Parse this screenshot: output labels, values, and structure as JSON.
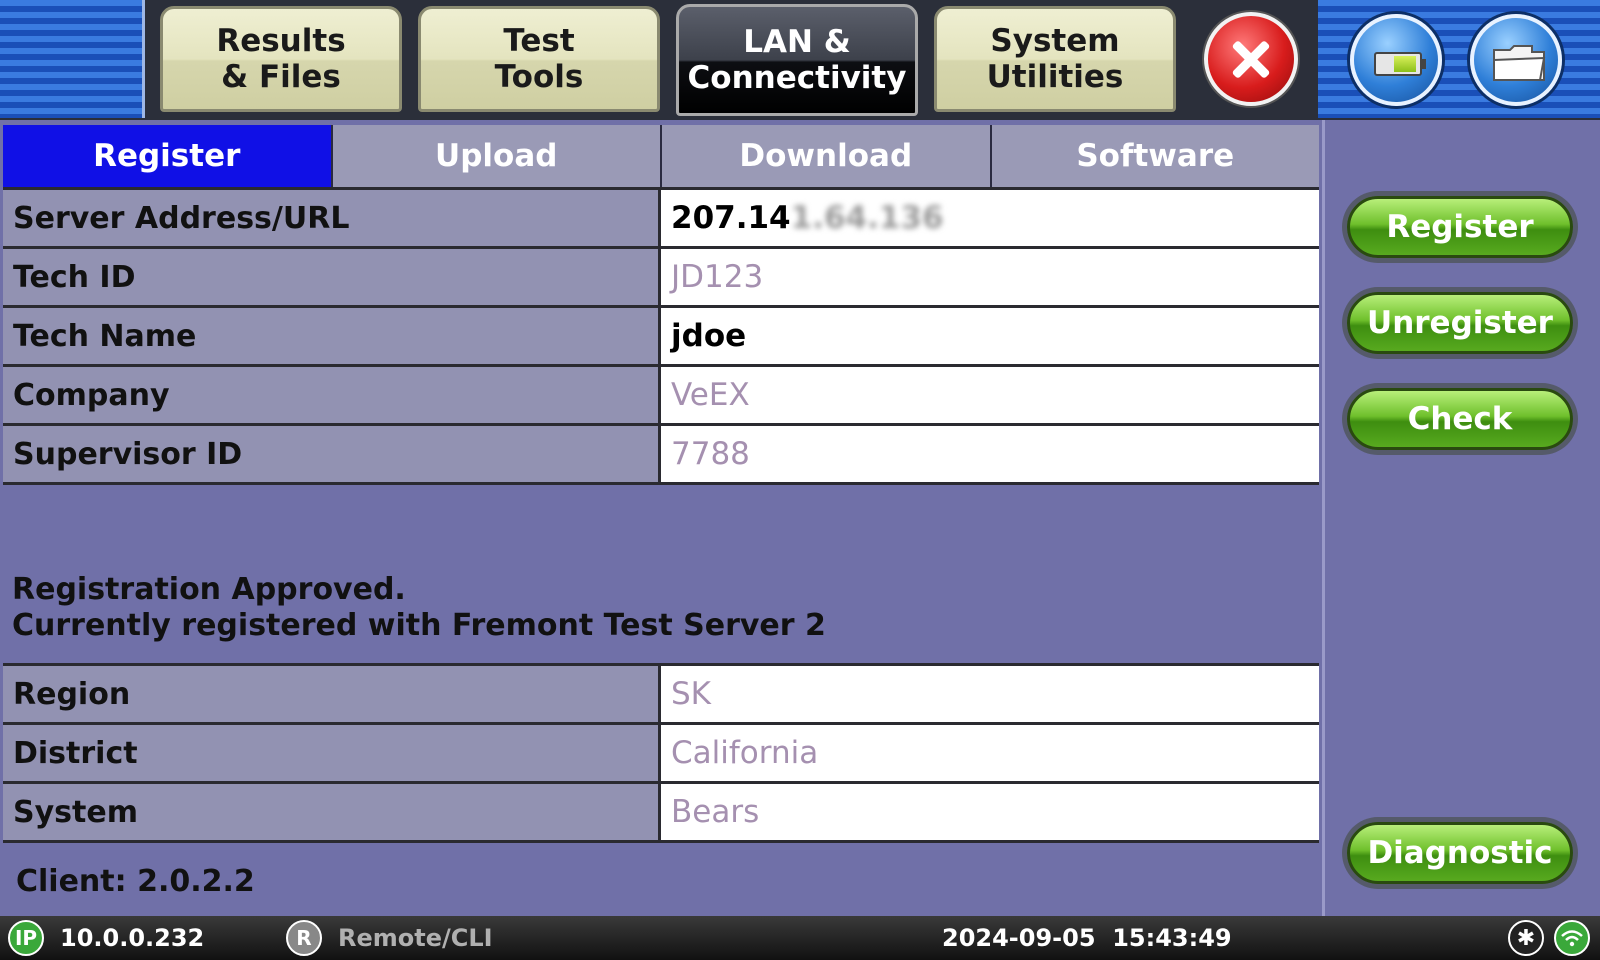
{
  "top_tabs": [
    {
      "line1": "Results",
      "line2": "& Files"
    },
    {
      "line1": "Test",
      "line2": "Tools"
    },
    {
      "line1": "LAN &",
      "line2": "Connectivity",
      "active": true
    },
    {
      "line1": "System",
      "line2": "Utilities"
    }
  ],
  "icons": {
    "close": "close-icon",
    "battery": "battery-icon",
    "folder": "folder-icon"
  },
  "sub_tabs": [
    "Register",
    "Upload",
    "Download",
    "Software"
  ],
  "form": {
    "server": {
      "label": "Server Address/URL",
      "value": "207.14",
      "value_masked": "1.64.136"
    },
    "tech_id": {
      "label": "Tech ID",
      "value": "JD123"
    },
    "tech_name": {
      "label": "Tech Name",
      "value": "jdoe"
    },
    "company": {
      "label": "Company",
      "value": "VeEX"
    },
    "supervisor": {
      "label": "Supervisor ID",
      "value": "7788"
    }
  },
  "status": {
    "line1": "Registration Approved.",
    "line2": "Currently registered with Fremont Test Server 2"
  },
  "info": {
    "region": {
      "label": "Region",
      "value": "SK"
    },
    "district": {
      "label": "District",
      "value": "California"
    },
    "system": {
      "label": "System",
      "value": "Bears"
    }
  },
  "client_version": "Client: 2.0.2.2",
  "buttons": {
    "register": "Register",
    "unregister": "Unregister",
    "check": "Check",
    "diagnostic": "Diagnostic"
  },
  "statusbar": {
    "ip_badge": "IP",
    "ip": "10.0.0.232",
    "remote_badge": "R",
    "remote": "Remote/CLI",
    "datetime": "2024-09-05  15:43:49"
  },
  "colors": {
    "active_subtab": "#1010e6",
    "panel": "#7070a8",
    "button_green": "#6fc02c"
  }
}
